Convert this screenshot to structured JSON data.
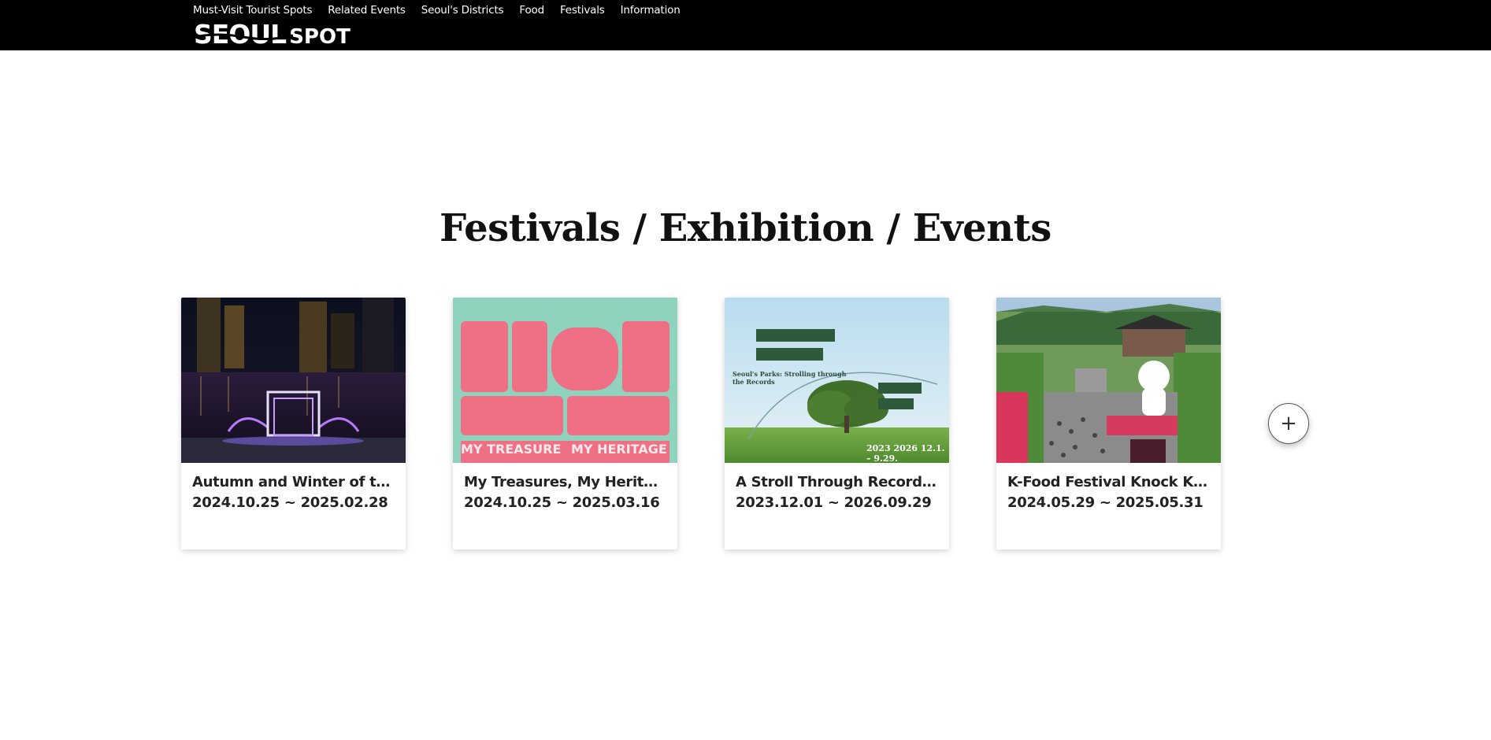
{
  "header": {
    "nav": [
      "Must-Visit Tourist Spots",
      "Related Events",
      "Seoul's Districts",
      "Food",
      "Festivals",
      "Information"
    ],
    "logo_main": "SEOUL",
    "logo_sub": "SPOT"
  },
  "section": {
    "title": "Festivals / Exhibition / Events"
  },
  "cards": [
    {
      "title": "Autumn and Winter of the l…",
      "date": "2024.10.25 ~ 2025.02.28"
    },
    {
      "title": "My Treasures, My Heritage",
      "date": "2024.10.25 ~ 2025.03.16",
      "poster_left": "MY TREASURE",
      "poster_right": "MY HERITAGE"
    },
    {
      "title": "A Stroll Through Records: …",
      "date": "2023.12.01 ~ 2026.09.29",
      "poster_sub": "Seoul's Parks: Strolling through the Records",
      "poster_dates": "2023 2026 12.1. – 9.29."
    },
    {
      "title": "K-Food Festival Knock Knock",
      "date": "2024.05.29 ~ 2025.05.31"
    }
  ],
  "more_button": {
    "label": "+"
  },
  "colors": {
    "header_bg": "#000000",
    "poster_mint": "#8fd3bf",
    "poster_pink": "#ef6f84"
  }
}
